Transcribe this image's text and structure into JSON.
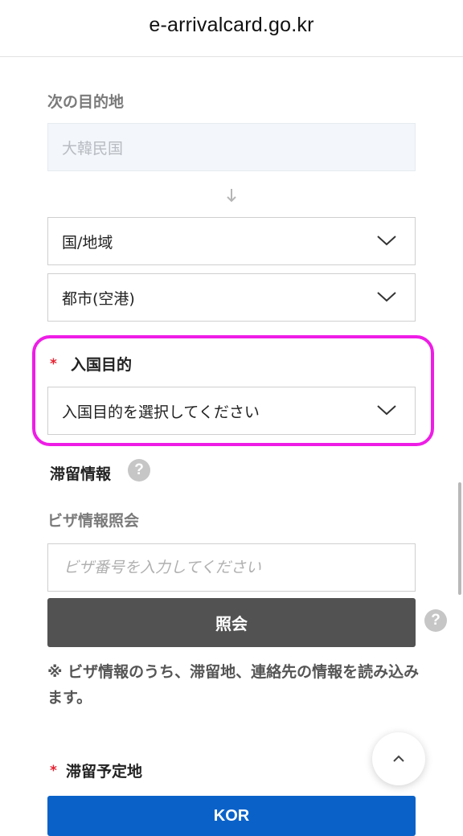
{
  "browser": {
    "url": "e-arrivalcard.go.kr"
  },
  "next_destination": {
    "label": "次の目的地",
    "fixed_value": "大韓民国",
    "country_select": "国/地域",
    "city_select": "都市(空港)"
  },
  "purpose": {
    "required_mark": "*",
    "label": "入国目的",
    "select_placeholder": "入国目的を選択してください"
  },
  "stay_info": {
    "heading": "滞留情報",
    "help": "?",
    "visa_label": "ビザ情報照会",
    "visa_placeholder": "ビザ番号を入力してください",
    "lookup_button": "照会",
    "lookup_help": "?",
    "note": "※ ビザ情報のうち、滞留地、連絡先の情報を読み込みます。"
  },
  "planned_stay": {
    "required_mark": "*",
    "label": "滞留予定地",
    "button": "KOR"
  },
  "colors": {
    "highlight": "#ee1de6",
    "primary": "#0a62c9",
    "dark_button": "#525252",
    "required": "#e8202f"
  }
}
